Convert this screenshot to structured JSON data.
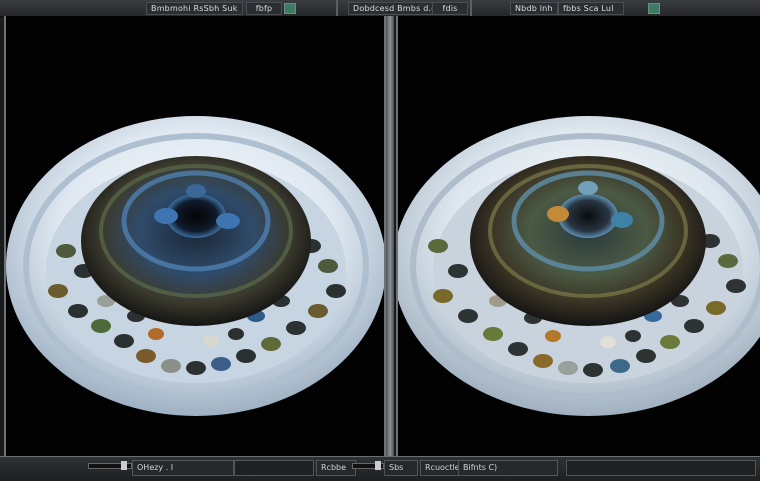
{
  "toolbar": {
    "left_title": "Bmbmohi RsSbh Suk",
    "left_button": "fbfp",
    "center_title": "Dobdcesd Bmbs d.d",
    "center_button": "fdis",
    "right_title": "Nbdb lnh",
    "right_button": "fbbs Sca Lul"
  },
  "viewports": {
    "left": {
      "icon": "rendered-dish-left"
    },
    "right": {
      "icon": "rendered-dish-right"
    }
  },
  "statusbar": {
    "left_label": "OHezy . I",
    "center_label": "Rcbbe",
    "center_value": "Sbs",
    "right_label": "Rcuoctled",
    "right_value": "Bifnts C)"
  },
  "colors": {
    "accent": "#3f7a63",
    "panel_bg": "#020202",
    "plate": "#e6eef5"
  }
}
